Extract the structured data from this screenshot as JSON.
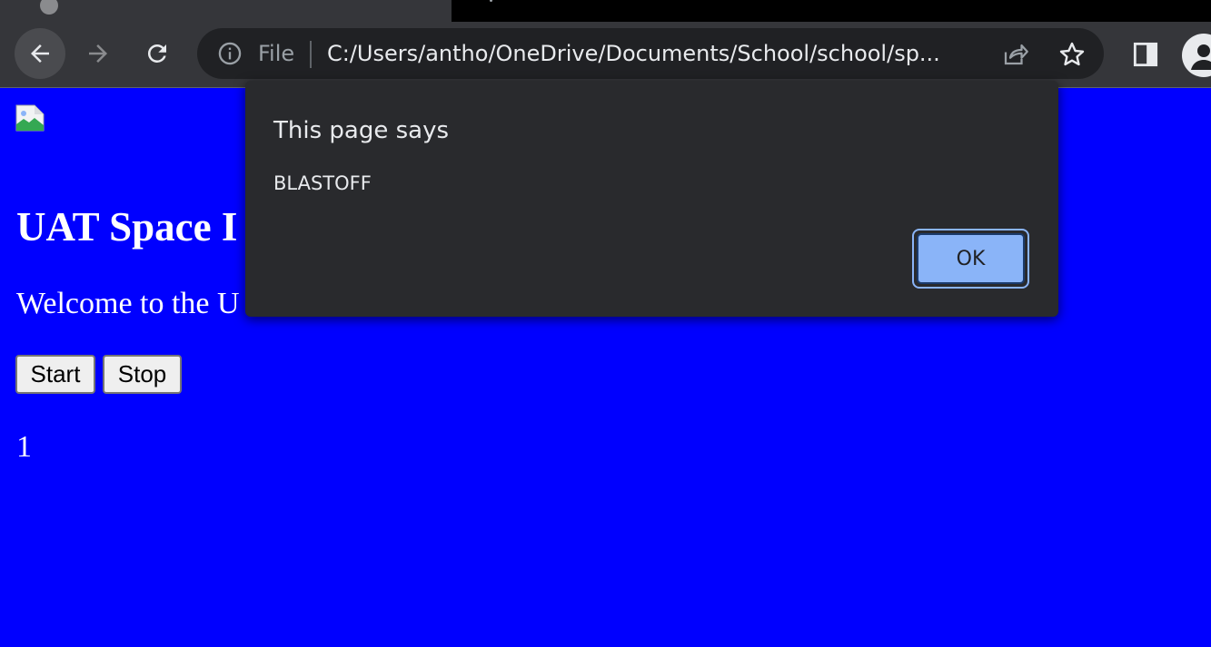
{
  "browser": {
    "tab": {
      "favicon_icon": "page-icon"
    },
    "toolbar": {
      "back_icon": "arrow-left-icon",
      "forward_icon": "arrow-right-icon",
      "reload_icon": "reload-icon"
    },
    "omnibox": {
      "info_icon": "info-icon",
      "scheme_label": "File",
      "url": "C:/Users/antho/OneDrive/Documents/School/school/sp...",
      "share_icon": "share-icon",
      "star_icon": "star-icon"
    },
    "side_panel_icon": "side-panel-icon",
    "profile_icon": "profile-icon"
  },
  "page": {
    "background_color": "#0000ff",
    "broken_image_icon": "broken-image-icon",
    "title": "UAT Space I",
    "welcome": "Welcome to the U",
    "buttons": {
      "start_label": "Start",
      "stop_label": "Stop"
    },
    "counter": "1"
  },
  "alert": {
    "title": "This page says",
    "message": "BLASTOFF",
    "ok_label": "OK",
    "accent_color": "#8ab4f8"
  }
}
